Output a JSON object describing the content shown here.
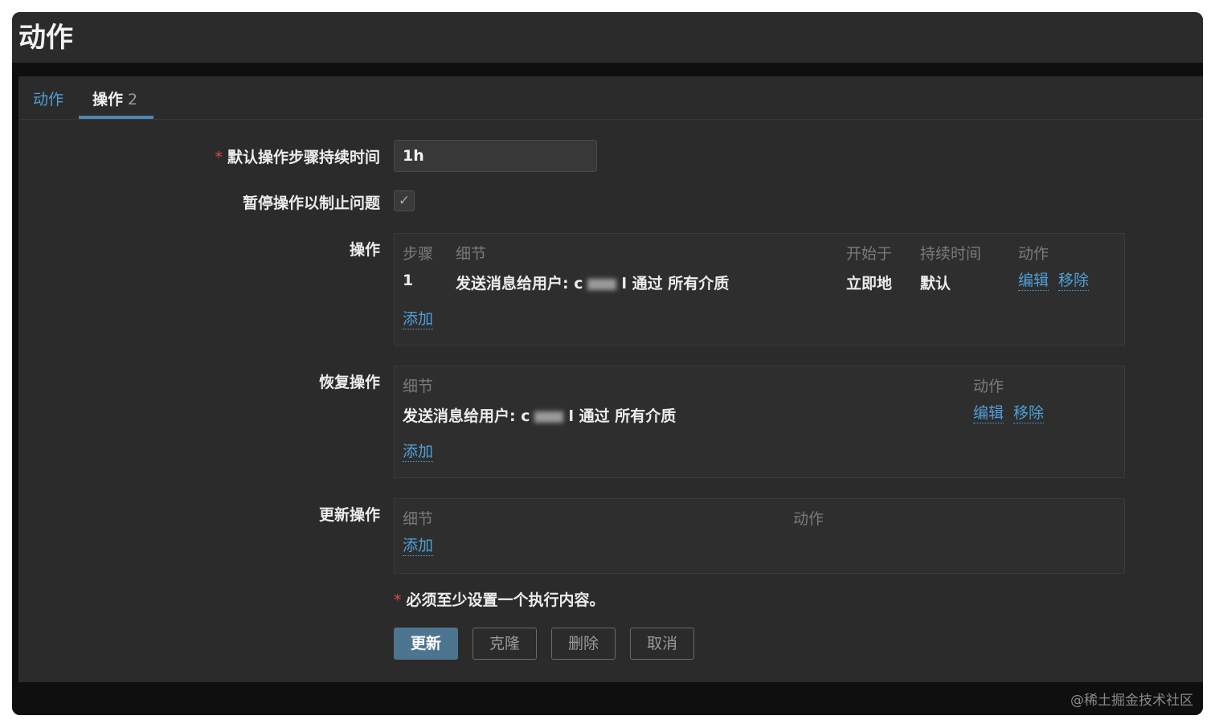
{
  "page": {
    "title": "动作"
  },
  "tabs": [
    {
      "label": "动作"
    },
    {
      "label": "操作",
      "count": "2"
    }
  ],
  "form": {
    "step_duration": {
      "label": "默认操作步骤持续时间",
      "required_mark": "*",
      "value": "1h"
    },
    "pause": {
      "label": "暂停操作以制止问题",
      "checked": true,
      "check_glyph": "✓"
    },
    "operations": {
      "label": "操作",
      "headers": [
        "步骤",
        "细节",
        "开始于",
        "持续时间",
        "动作"
      ],
      "rows": [
        {
          "step": "1",
          "detail_prefix": "发送消息给用户: c",
          "detail_suffix": "l 通过 所有介质",
          "start": "立即地",
          "duration": "默认",
          "edit": "编辑",
          "remove": "移除"
        }
      ],
      "add": "添加"
    },
    "recovery": {
      "label": "恢复操作",
      "headers": [
        "细节",
        "动作"
      ],
      "rows": [
        {
          "detail_prefix": "发送消息给用户: c",
          "detail_suffix": "l 通过 所有介质",
          "edit": "编辑",
          "remove": "移除"
        }
      ],
      "add": "添加"
    },
    "update": {
      "label": "更新操作",
      "headers": [
        "细节",
        "动作"
      ],
      "add": "添加"
    },
    "note": {
      "required_mark": "*",
      "text": "必须至少设置一个执行内容。"
    }
  },
  "buttons": {
    "update": "更新",
    "clone": "克隆",
    "delete": "删除",
    "cancel": "取消"
  },
  "watermark": "@稀土掘金技术社区",
  "colors": {
    "link": "#4f9fd6",
    "primary": "#4d7590",
    "required": "#e0493a"
  }
}
